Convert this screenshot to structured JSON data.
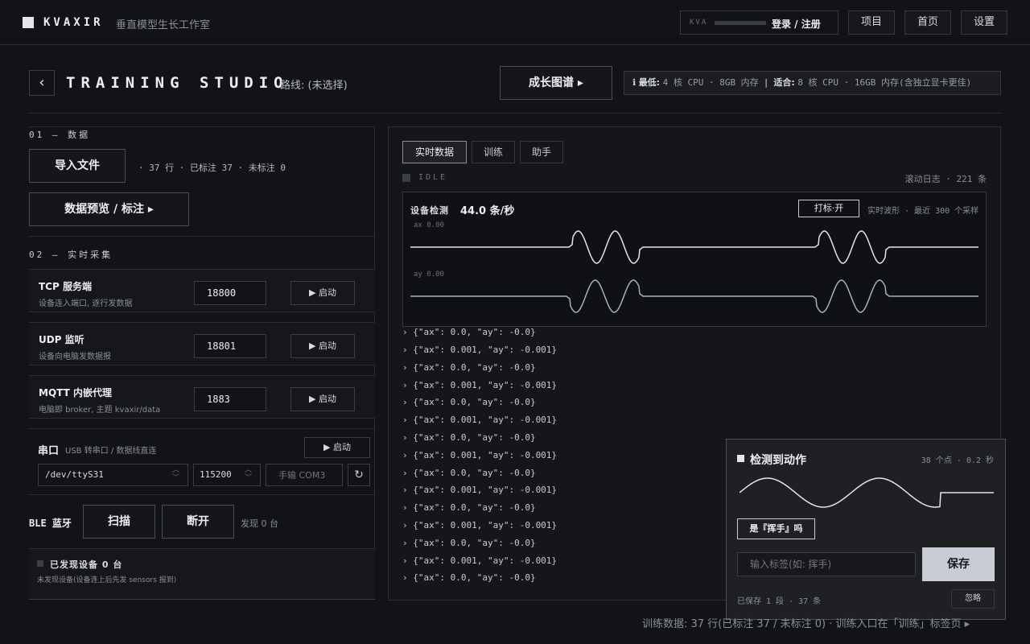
{
  "topbar": {
    "brand": "KVAXIR",
    "subtitle": "垂直模型生长工作室",
    "login_prefix": "KVA",
    "login_label": "登录 / 注册",
    "nav": [
      "项目",
      "首页",
      "设置"
    ]
  },
  "header": {
    "back_glyph": "‹",
    "title": "TRAINING STUDIO",
    "route": "路线: (未选择)",
    "growth_button": "成长图谱 ▸",
    "requirements": {
      "icon": "info-icon",
      "min_label": "最低:",
      "min_value": "4 核 CPU · 8GB 内存",
      "sep": "|",
      "fit_label": "适合:",
      "fit_value": "8 核 CPU · 16GB 内存(含独立显卡更佳)"
    }
  },
  "data_section": {
    "label": "01 — 数据",
    "import_button": "导入文件",
    "stats": "· 37 行 · 已标注 37 · 未标注 0",
    "preview_button": "数据预览 / 标注 ▸"
  },
  "capture_section": {
    "label": "02 — 实时采集",
    "services": [
      {
        "name": "TCP 服务端",
        "desc": "设备连入端口, 逐行发数据",
        "port": "18800",
        "start": "▶ 启动"
      },
      {
        "name": "UDP 监听",
        "desc": "设备向电脑发数据报",
        "port": "18801",
        "start": "▶ 启动"
      },
      {
        "name": "MQTT 内嵌代理",
        "desc": "电脑即 broker, 主题 kvaxir/data",
        "port": "1883",
        "start": "▶ 启动"
      }
    ],
    "serial": {
      "name": "串口",
      "desc": "USB 转串口 / 数据线直连",
      "start": "▶ 启动",
      "device": "/dev/ttyS31",
      "baud": "115200",
      "manual_placeholder": "手输 COM3",
      "refresh_glyph": "↻"
    },
    "ble": {
      "name": "BLE 蓝牙",
      "scan": "扫描",
      "disconnect": "断开",
      "found": "发现 0 台"
    },
    "discovered": {
      "title": "已发现设备 0 台",
      "note": "未发现设备(设备连上后先发 sensors 报到)"
    }
  },
  "right": {
    "tabs": [
      "实时数据",
      "训练",
      "助手"
    ],
    "status": "IDLE",
    "scroll_log": "滚动日志 · 221 条",
    "wave": {
      "title": "设备检测",
      "rate": "44.0 条/秒",
      "mark_button": "打标·开",
      "caption": "实时波形 · 最近 300 个采样",
      "ax_label": "ax  0.00",
      "ay_label": "ay  0.00",
      "ax_color": "#e4e6ea",
      "ay_color": "#9fb4c8"
    },
    "log_lines": [
      "› {\"ax\": 0.001, \"ay\": -0.001}",
      "› {\"ax\": 0.0, \"ay\": -0.0}",
      "› {\"ax\": 0.001, \"ay\": -0.001}",
      "› {\"ax\": 0.0, \"ay\": -0.0}",
      "› {\"ax\": 0.001, \"ay\": -0.001}",
      "› {\"ax\": 0.0, \"ay\": -0.0}",
      "› {\"ax\": 0.001, \"ay\": -0.001}",
      "› {\"ax\": 0.0, \"ay\": -0.0}",
      "› {\"ax\": 0.001, \"ay\": -0.001}",
      "› {\"ax\": 0.0, \"ay\": -0.0}",
      "› {\"ax\": 0.001, \"ay\": -0.001}",
      "› {\"ax\": 0.0, \"ay\": -0.0}",
      "› {\"ax\": 0.001, \"ay\": -0.001}",
      "› {\"ax\": 0.0, \"ay\": -0.0}"
    ]
  },
  "popup": {
    "title": "检测到动作",
    "meta": "38 个点 · 0.2 秒",
    "question": "是『挥手』吗",
    "input_placeholder": "输入标签(如: 挥手)",
    "save": "保存",
    "saved": "已保存 1 段 · 37 条",
    "ignore": "忽略"
  },
  "footer": "训练数据: 37 行(已标注 37 / 未标注 0) · 训练入口在「训练」标签页 ▸"
}
